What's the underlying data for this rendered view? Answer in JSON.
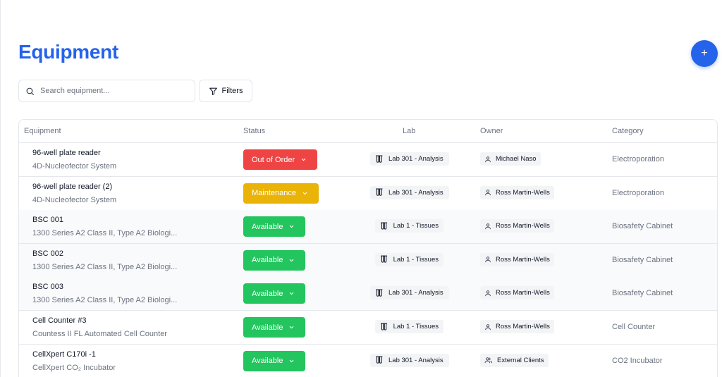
{
  "page": {
    "title": "Equipment",
    "add_button": "+",
    "search_placeholder": "Search equipment...",
    "filters_label": "Filters",
    "primary_color": "#2563eb"
  },
  "table": {
    "headers": {
      "equipment": "Equipment",
      "status": "Status",
      "lab": "Lab",
      "owner": "Owner",
      "category": "Category"
    },
    "rows": [
      {
        "name": "96-well plate reader",
        "model": "4D-Nucleofector System",
        "status": "Out of Order",
        "status_color": "#ef4444",
        "lab": "Lab 301 - Analysis",
        "owner": "Michael Naso",
        "owner_icon": "user-icon",
        "category": "Electroporation"
      },
      {
        "name": "96-well plate reader (2)",
        "model": "4D-Nucleofector System",
        "status": "Maintenance",
        "status_color": "#eab308",
        "lab": "Lab 301 - Analysis",
        "owner": "Ross Martin-Wells",
        "owner_icon": "user-icon",
        "category": "Electroporation"
      },
      {
        "name": "BSC 001",
        "model": "1300 Series A2 Class II, Type A2 Biologi...",
        "status": "Available",
        "status_color": "#22c55e",
        "lab": "Lab 1 - Tissues",
        "owner": "Ross Martin-Wells",
        "owner_icon": "user-icon",
        "category": "Biosafety Cabinet"
      },
      {
        "name": "BSC 002",
        "model": "1300 Series A2 Class II, Type A2 Biologi...",
        "status": "Available",
        "status_color": "#22c55e",
        "lab": "Lab 1 - Tissues",
        "owner": "Ross Martin-Wells",
        "owner_icon": "user-icon",
        "category": "Biosafety Cabinet"
      },
      {
        "name": "BSC 003",
        "model": "1300 Series A2 Class II, Type A2 Biologi...",
        "status": "Available",
        "status_color": "#22c55e",
        "lab": "Lab 301 - Analysis",
        "owner": "Ross Martin-Wells",
        "owner_icon": "user-icon",
        "category": "Biosafety Cabinet"
      },
      {
        "name": "Cell Counter #3",
        "model": "Countess II FL Automated Cell Counter",
        "status": "Available",
        "status_color": "#22c55e",
        "lab": "Lab 1 - Tissues",
        "owner": "Ross Martin-Wells",
        "owner_icon": "user-icon",
        "category": "Cell Counter"
      },
      {
        "name": "CellXpert C170i -1",
        "model": "CellXpert CO₂ Incubator",
        "status": "Available",
        "status_color": "#22c55e",
        "lab": "Lab 301 - Analysis",
        "owner": "External Clients",
        "owner_icon": "users-icon",
        "category": "CO2 Incubator"
      }
    ]
  }
}
